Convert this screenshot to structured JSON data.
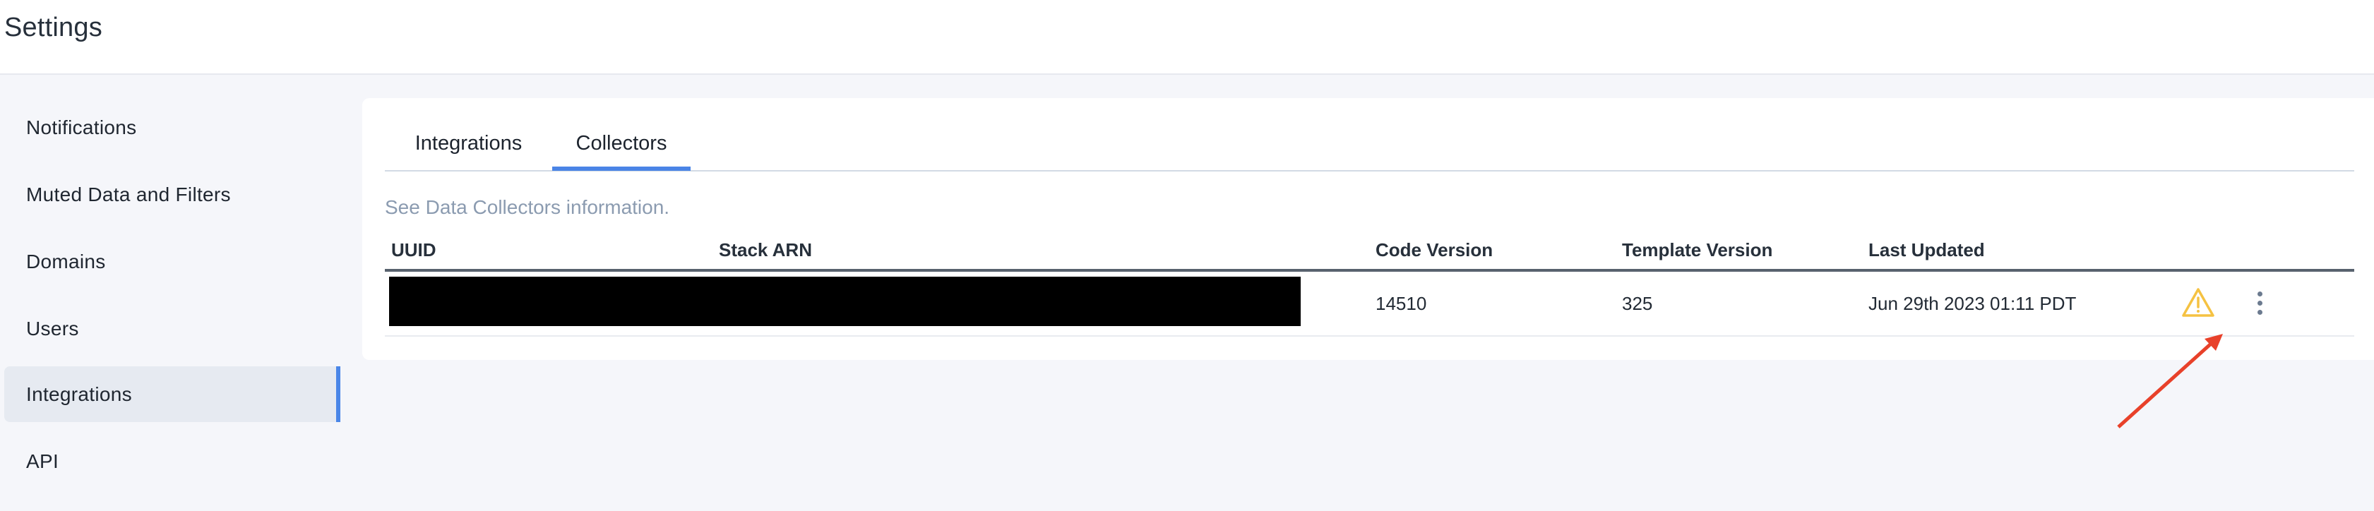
{
  "header": {
    "title": "Settings"
  },
  "sidebar": {
    "items": [
      {
        "label": "Notifications",
        "active": false
      },
      {
        "label": "Muted Data and Filters",
        "active": false
      },
      {
        "label": "Domains",
        "active": false
      },
      {
        "label": "Users",
        "active": false
      },
      {
        "label": "Integrations",
        "active": true
      },
      {
        "label": "API",
        "active": false
      }
    ]
  },
  "main": {
    "tabs": [
      {
        "label": "Integrations",
        "active": false
      },
      {
        "label": "Collectors",
        "active": true
      }
    ],
    "subtitle": "See Data Collectors information.",
    "table": {
      "columns": [
        "UUID",
        "Stack ARN",
        "Code Version",
        "Template Version",
        "Last Updated"
      ],
      "rows": [
        {
          "uuid": "[redacted]",
          "stack_arn": "[redacted]",
          "code_version": "14510",
          "template_version": "325",
          "last_updated": "Jun 29th 2023 01:11 PDT",
          "status_icon": "warning-icon",
          "actions_icon": "kebab-menu-icon"
        }
      ]
    }
  },
  "colors": {
    "accent": "#4a84e6",
    "warning": "#f5c242",
    "annotation_arrow": "#e8412a",
    "subtitle_text": "#8b9bb0"
  },
  "annotation": {
    "type": "arrow",
    "points_to": "warning-icon"
  }
}
